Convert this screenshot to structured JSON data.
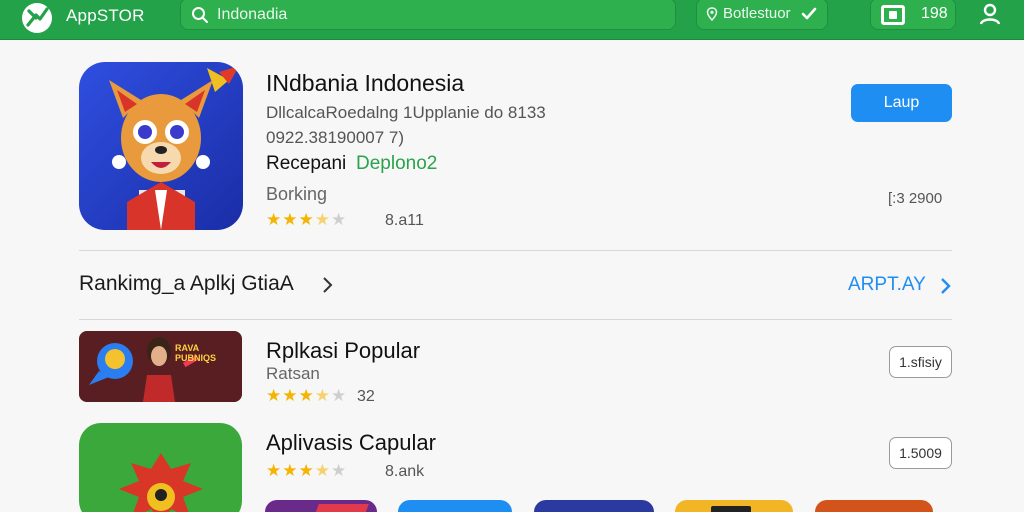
{
  "header": {
    "app_name": "AppSTOR",
    "search_placeholder": "Indonadia",
    "location_label": "Botlestuor",
    "badge_count": "198"
  },
  "featured": {
    "title": "INdbania Indonesia",
    "description_line1": "DllcalcaRoedalng 1Upplanie do 8133",
    "description_line2": "0922.38190007 7)",
    "developer_label": "Recepani",
    "developer_name": "Deplono2",
    "category": "Borking",
    "rating": 3.5,
    "rating_count": "8.a11",
    "button_label": "Laup",
    "size": "[:3 2900"
  },
  "section": {
    "title": "Rankimg_a Aplkj GtiaA",
    "see_all_label": "ARPT.AY"
  },
  "items": [
    {
      "title": "Rplkasi Popular",
      "subtitle": "Ratsan",
      "rating": 3.5,
      "rating_count": "32",
      "button_label": "1.sfisiy",
      "thumb_text": "RAVA PUBNIQS"
    },
    {
      "title": "Aplivasis Capular",
      "rating": 3.5,
      "rating_count": "8.ank",
      "button_label": "1.5009"
    }
  ],
  "colors": {
    "brand_green": "#23a24a",
    "accent_blue": "#1e8ef2",
    "star": "#f4b400"
  },
  "icons": [
    "logo-icon",
    "search-icon",
    "location-icon",
    "check-icon",
    "tv-icon",
    "user-icon",
    "chevron-right-icon"
  ]
}
